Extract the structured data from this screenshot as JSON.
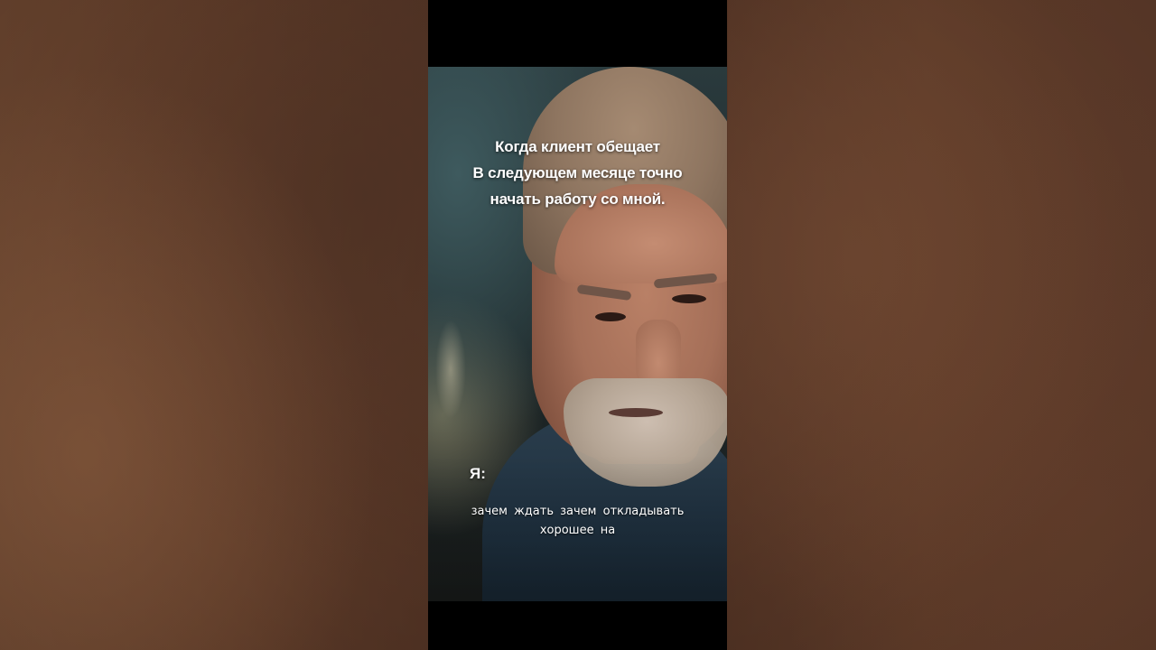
{
  "caption": {
    "lines": [
      "Когда клиент обещает",
      "В следующем месяце точно",
      "начать работу со мной."
    ]
  },
  "speaker": {
    "label": "Я:"
  },
  "subtitle": {
    "lines": [
      "зачем ждать зачем откладывать",
      "хорошее на"
    ]
  },
  "colors": {
    "side_background": "#6e452f",
    "frame_bars": "#000000",
    "text": "#ffffff"
  }
}
